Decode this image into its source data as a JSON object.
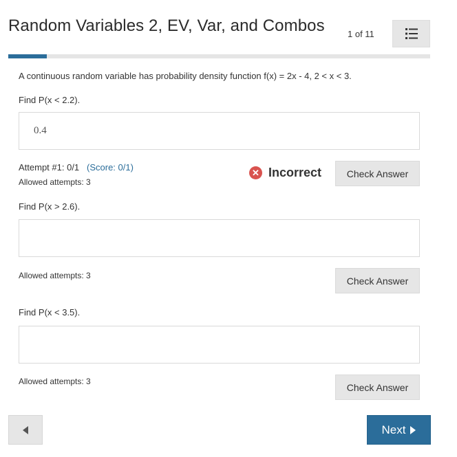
{
  "header": {
    "title": "Random Variables 2, EV, Var, and Combos",
    "counter": "1 of 11",
    "menu_icon": "list-icon",
    "progress_fraction": 0.0909
  },
  "problem": {
    "statement": "A continuous random variable has probability density function f(x) = 2x - 4, 2 < x < 3."
  },
  "parts": [
    {
      "prompt": "Find P(x < 2.2).",
      "answer_value": "0.4",
      "attempt_text": "Attempt #1: 0/1",
      "score_text": "(Score: 0/1)",
      "allowed_attempts": "Allowed attempts: 3",
      "feedback": "Incorrect",
      "check_label": "Check Answer"
    },
    {
      "prompt": "Find P(x > 2.6).",
      "answer_value": "",
      "allowed_attempts": "Allowed attempts: 3",
      "check_label": "Check Answer"
    },
    {
      "prompt": "Find P(x < 3.5).",
      "answer_value": "",
      "allowed_attempts": "Allowed attempts: 3",
      "check_label": "Check Answer"
    }
  ],
  "nav": {
    "next_label": "Next",
    "prev_icon": "triangle-left-icon",
    "next_icon": "triangle-right-icon"
  },
  "colors": {
    "accent": "#2b6d9a",
    "error": "#d9534f",
    "button_gray": "#e6e6e6"
  }
}
